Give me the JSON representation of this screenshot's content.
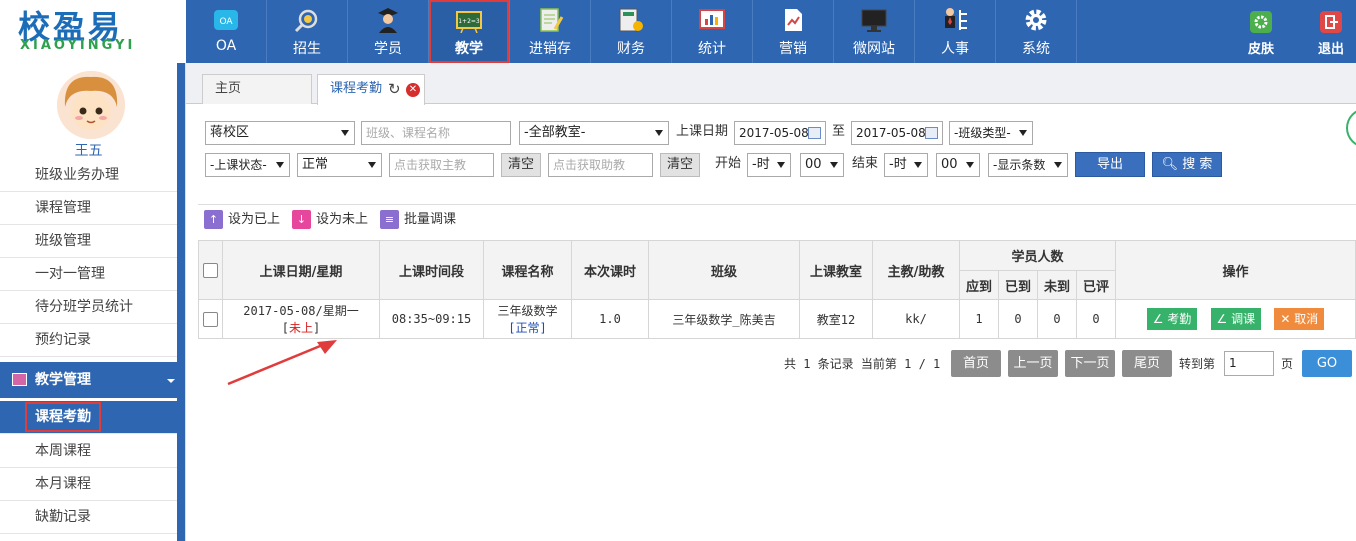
{
  "logo": {
    "cn": "校盈易",
    "en": "XIAOYINGYI"
  },
  "nav": [
    {
      "label": "OA",
      "icon": "oa-icon"
    },
    {
      "label": "招生",
      "icon": "recruit-icon"
    },
    {
      "label": "学员",
      "icon": "student-icon"
    },
    {
      "label": "教学",
      "icon": "teaching-icon",
      "active": true
    },
    {
      "label": "进销存",
      "icon": "inventory-icon"
    },
    {
      "label": "财务",
      "icon": "finance-icon"
    },
    {
      "label": "统计",
      "icon": "statistics-icon"
    },
    {
      "label": "营销",
      "icon": "marketing-icon"
    },
    {
      "label": "微网站",
      "icon": "microsite-icon"
    },
    {
      "label": "人事",
      "icon": "hr-icon"
    },
    {
      "label": "系统",
      "icon": "gear-icon"
    }
  ],
  "nav_right": [
    {
      "label": "皮肤",
      "icon": "skin-icon"
    },
    {
      "label": "退出",
      "icon": "logout-icon"
    }
  ],
  "user": {
    "name": "王五"
  },
  "sidebar": {
    "items_top": [
      "班级业务办理",
      "课程管理",
      "班级管理",
      "一对一管理",
      "待分班学员统计",
      "预约记录"
    ],
    "group": "教学管理",
    "items_bottom": [
      "课程考勤",
      "本周课程",
      "本月课程",
      "缺勤记录"
    ]
  },
  "tabs": {
    "home": "主页",
    "current": "课程考勤"
  },
  "filters": {
    "campus": "蒋校区",
    "class_search_placeholder": "班级、课程名称",
    "classroom": "-全部教室-",
    "date_label": "上课日期",
    "date_from": "2017-05-08",
    "date_to_label": "至",
    "date_to": "2017-05-08",
    "class_type": "-班级类型-",
    "class_status": "-上课状态-",
    "normal": "正常",
    "teacher_placeholder": "点击获取主教",
    "clear1": "清空",
    "assistant_placeholder": "点击获取助教",
    "clear2": "清空",
    "start_label": "开始",
    "start_hour": "-时",
    "start_min": "00",
    "end_label": "结束",
    "end_hour": "-时",
    "end_min": "00",
    "show_count": "-显示条数",
    "export": "导出",
    "search": "搜 索"
  },
  "toolbar": {
    "set_done": "设为已上",
    "set_undone": "设为未上",
    "batch_adjust": "批量调课"
  },
  "table": {
    "headers": {
      "date": "上课日期/星期",
      "time": "上课时间段",
      "course": "课程名称",
      "hours": "本次课时",
      "class": "班级",
      "room": "上课教室",
      "teacher": "主教/助教",
      "students": "学员人数",
      "should": "应到",
      "arrived": "已到",
      "absent": "未到",
      "rated": "已评",
      "ops": "操作"
    },
    "rows": [
      {
        "date": "2017-05-08/星期一",
        "status_open": "[",
        "status": "未上",
        "status_close": "]",
        "time": "08:35~09:15",
        "course": "三年级数学",
        "course_state": "[正常]",
        "hours": "1.0",
        "class": "三年级数学_陈美吉",
        "room": "教室12",
        "teacher": "kk/",
        "should": "1",
        "arrived": "0",
        "absent": "0",
        "rated": "0",
        "op1": "考勤",
        "op2": "调课",
        "op3": "取消"
      }
    ]
  },
  "pager": {
    "summary": "共 1 条记录 当前第 1 / 1",
    "first": "首页",
    "prev": "上一页",
    "next": "下一页",
    "last": "尾页",
    "goto_label": "转到第",
    "page_value": "1",
    "page_unit": "页",
    "go": "GO"
  },
  "colors": {
    "primary": "#2e66b1",
    "highlight": "#e03c3c",
    "green": "#36b26a",
    "orange": "#f08a3c"
  }
}
